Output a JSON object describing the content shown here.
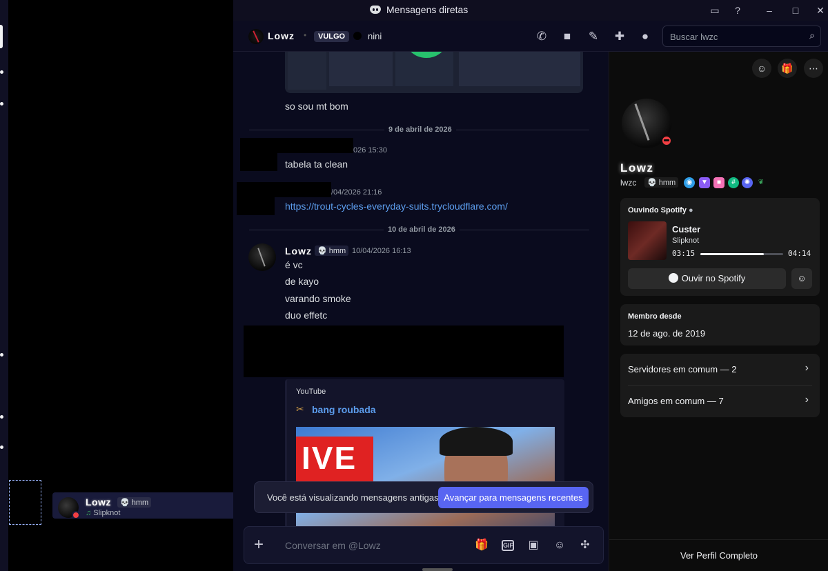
{
  "titlebar": {
    "title": "Mensagens diretas"
  },
  "header": {
    "name": "Lowz",
    "vulgo": "VULGO",
    "nickname": "nini",
    "search_placeholder": "Buscar lwzc"
  },
  "messages": {
    "m1_text": "so sou mt bom",
    "divider1": "9 de abril de 2026",
    "m2_time": "026 15:30",
    "m2_text": "tabela ta clean",
    "m3_time": "/04/2026 21:16",
    "m3_link": "https://trout-cycles-everyday-suits.trycloudflare.com/",
    "divider2": "10 de abril de 2026",
    "m4_name": "Lowz",
    "m4_tag": "hmm",
    "m4_time": "10/04/2026 16:13",
    "m4_lines": [
      "é vc",
      "de kayo",
      "varando smoke",
      "duo effetc"
    ],
    "embed_provider": "YouTube",
    "embed_title": "bang roubada",
    "thumb_text": "IVE"
  },
  "banner": {
    "text": "Você está visualizando mensagens antigas",
    "button": "Avançar para mensagens recentes"
  },
  "composer": {
    "placeholder": "Conversar em @Lowz",
    "gif_label": "GIF"
  },
  "userpanel": {
    "name": "Lowz",
    "tag": "hmm",
    "activity": "Slipknot"
  },
  "profile": {
    "display_name": "Lowz",
    "username": "lwzc",
    "tag": "hmm",
    "spotify_header": "Ouvindo Spotify",
    "track": "Custer",
    "artist": "Slipknot",
    "elapsed": "03:15",
    "duration": "04:14",
    "progress": 0.77,
    "listen_button": "Ouvir no Spotify",
    "member_since_label": "Membro desde",
    "member_since": "12 de ago. de 2019",
    "mutual_servers": "Servidores em comum — 2",
    "mutual_friends": "Amigos em comum — 7",
    "full_profile": "Ver Perfil Completo",
    "badge_colors": [
      "#2f9ee8",
      "#8b5cf6",
      "#f472b6",
      "#10b981",
      "#5865f2",
      "#3ba55c"
    ]
  },
  "colors": {
    "accent": "#5865f2",
    "link": "#5c9ded",
    "dnd": "#f23f43",
    "spotify_ring": "#27c26d"
  }
}
